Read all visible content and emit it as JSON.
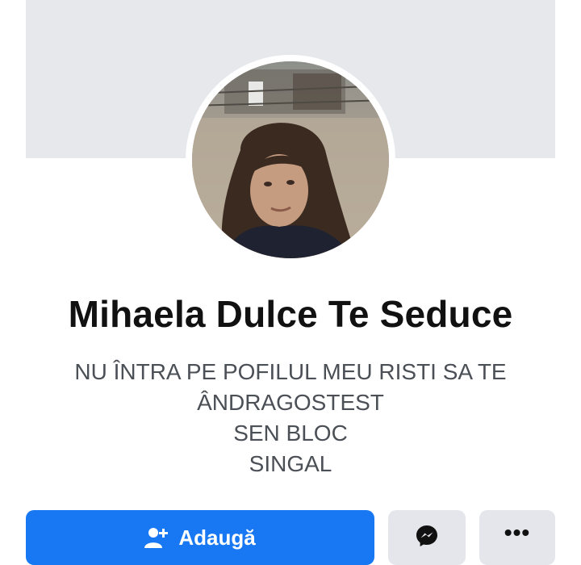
{
  "profile": {
    "name": "Mihaela Dulce Te Seduce",
    "bio_lines": [
      "NU ÎNTRA PE POFILUL MEU RISTI SA TE",
      "ÂNDRAGOSTEST",
      "SEN BLOC",
      "SINGAL"
    ]
  },
  "actions": {
    "add_label": "Adaugă",
    "add_icon": "add-friend-icon",
    "message_icon": "messenger-icon",
    "more_icon": "more-dots-icon",
    "more_glyph": "•••"
  },
  "colors": {
    "primary_button": "#1877f2",
    "secondary_button": "#e4e6eb",
    "cover": "#e6e8ec"
  }
}
